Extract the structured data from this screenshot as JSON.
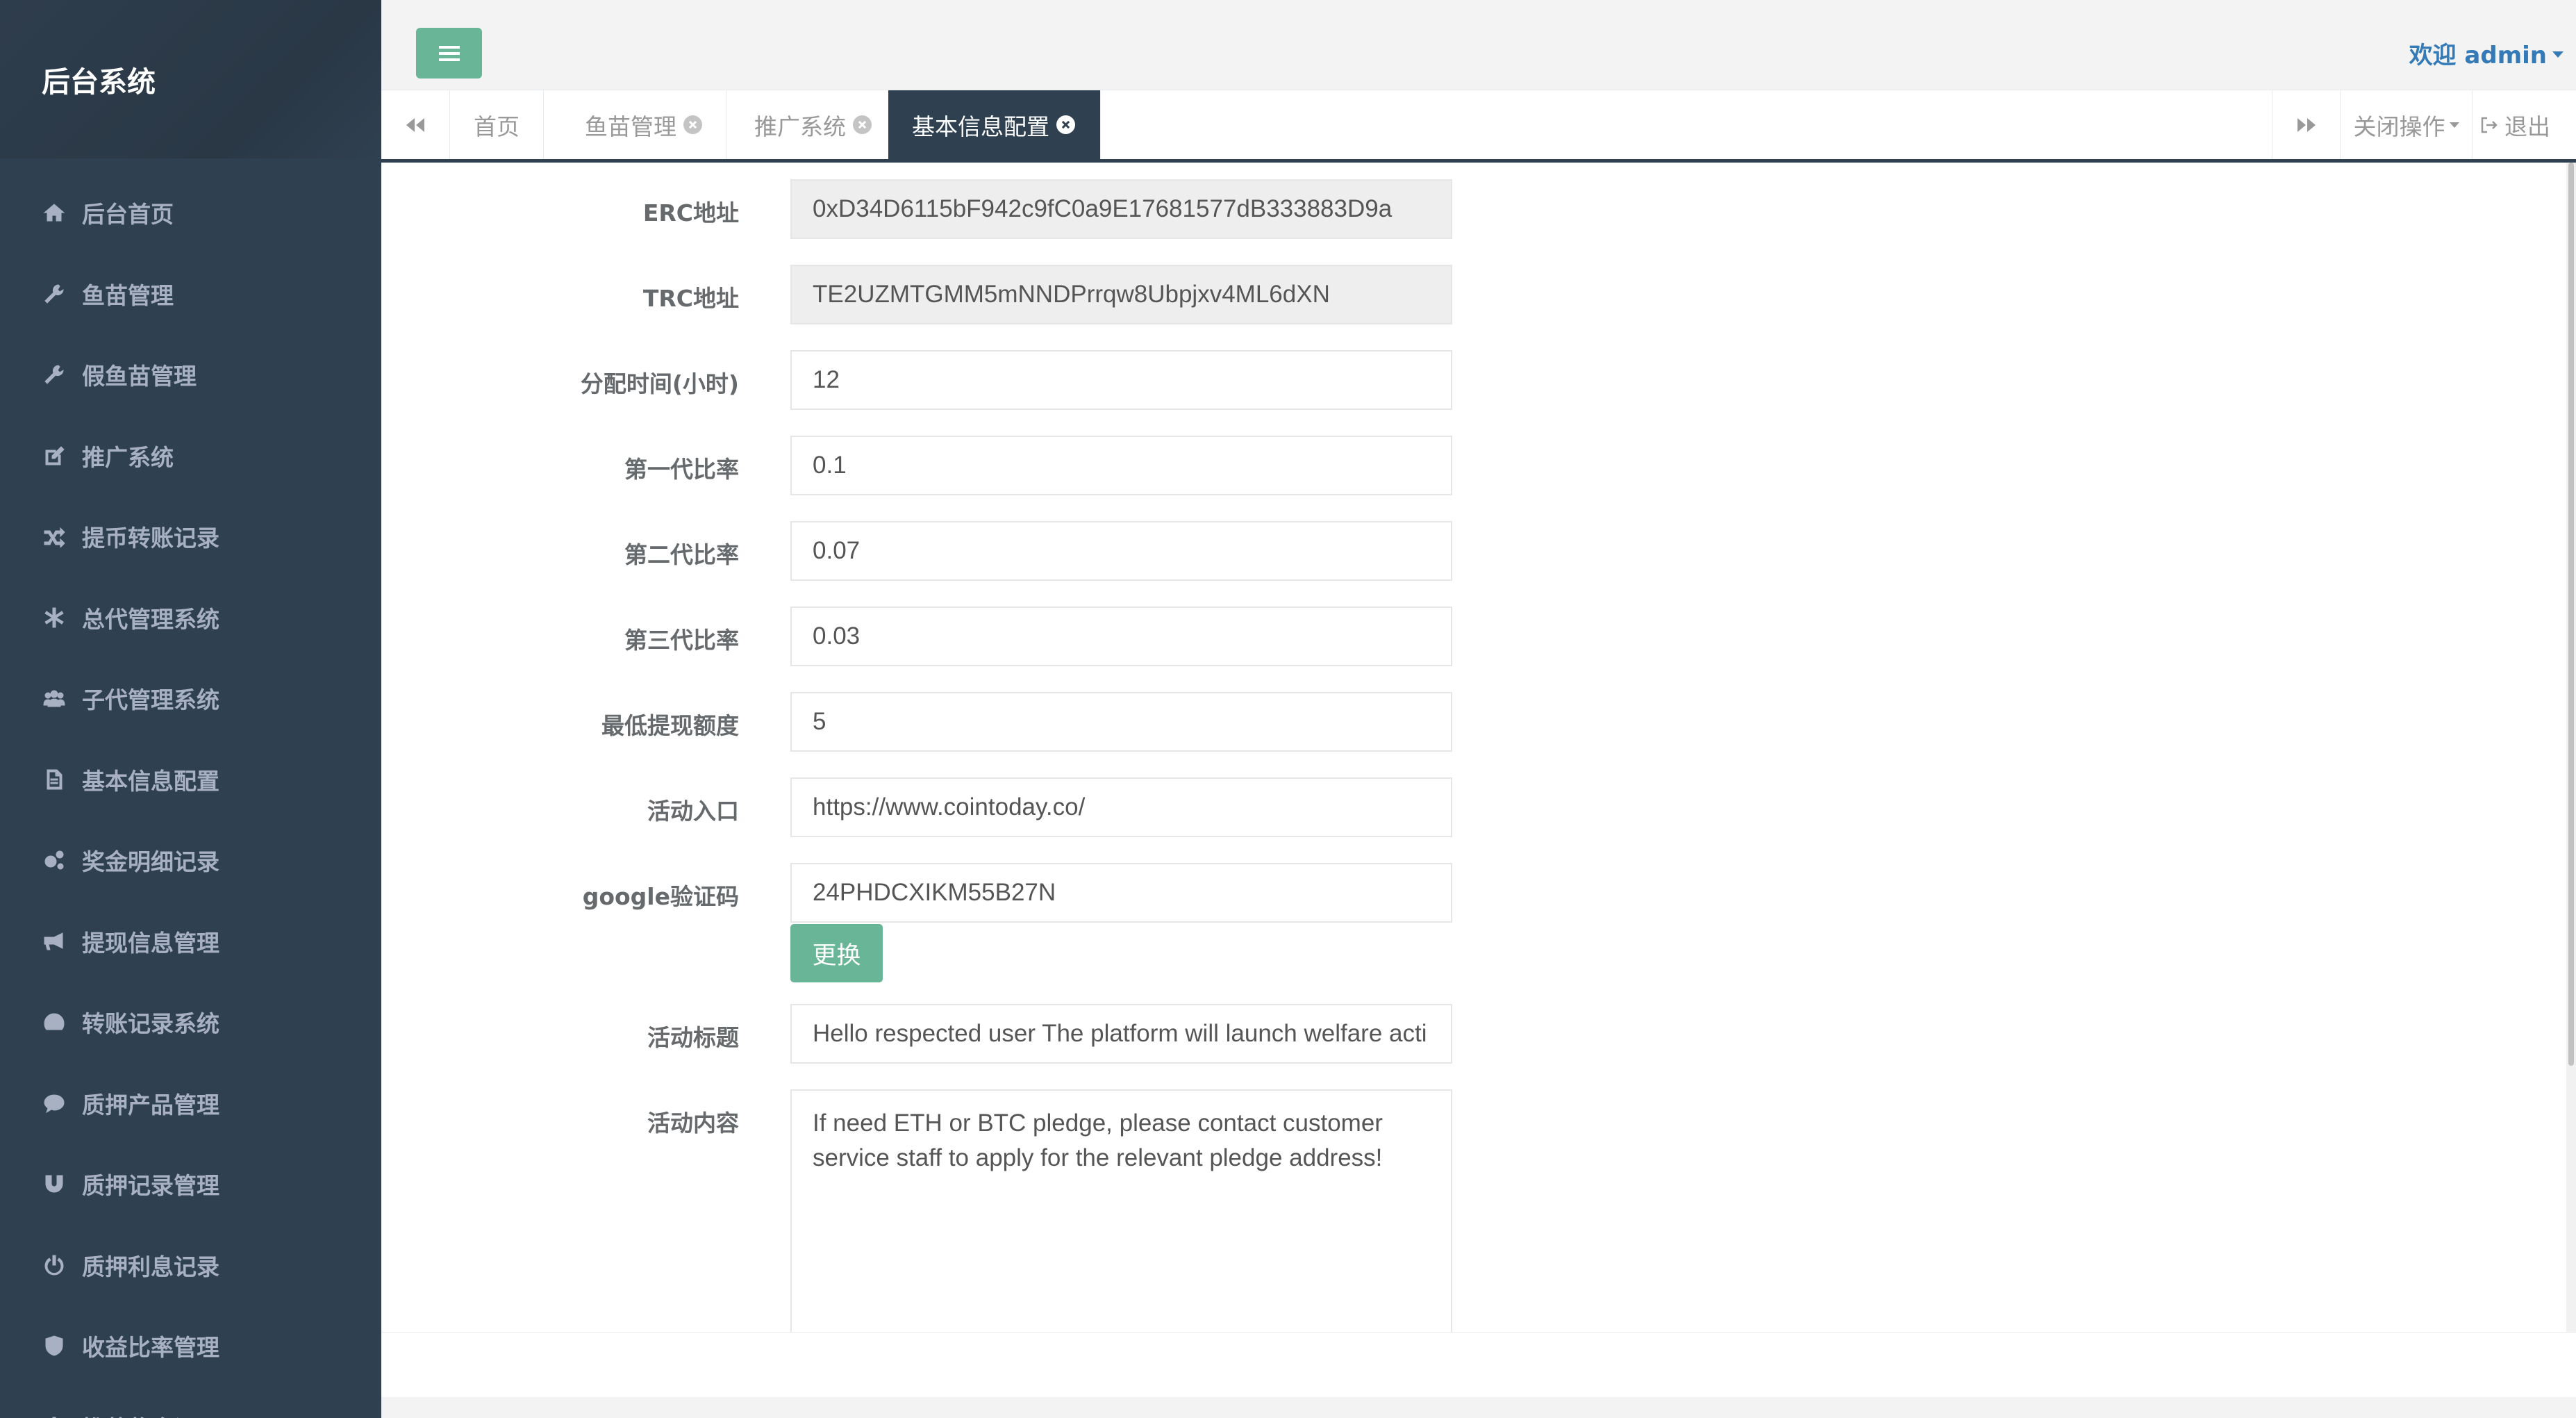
{
  "app": {
    "title": "后台系统"
  },
  "sidebar": {
    "items": [
      {
        "label": "后台首页",
        "icon": "home-icon"
      },
      {
        "label": "鱼苗管理",
        "icon": "wrench-icon"
      },
      {
        "label": "假鱼苗管理",
        "icon": "wrench-icon"
      },
      {
        "label": "推广系统",
        "icon": "edit-icon"
      },
      {
        "label": "提币转账记录",
        "icon": "shuffle-icon"
      },
      {
        "label": "总代管理系统",
        "icon": "asterisk-icon"
      },
      {
        "label": "子代管理系统",
        "icon": "users-icon"
      },
      {
        "label": "基本信息配置",
        "icon": "file-icon"
      },
      {
        "label": "奖金明细记录",
        "icon": "gears-icon"
      },
      {
        "label": "提现信息管理",
        "icon": "bullhorn-icon"
      },
      {
        "label": "转账记录系统",
        "icon": "dashboard-icon"
      },
      {
        "label": "质押产品管理",
        "icon": "comment-icon"
      },
      {
        "label": "质押记录管理",
        "icon": "magnet-icon"
      },
      {
        "label": "质押利息记录",
        "icon": "power-icon"
      },
      {
        "label": "收益比率管理",
        "icon": "shield-icon"
      },
      {
        "label": "推荐奖金记录",
        "icon": "power-icon"
      }
    ]
  },
  "header": {
    "welcome": "欢迎 admin"
  },
  "tabs": {
    "items": [
      {
        "label": "首页"
      },
      {
        "label": "鱼苗管理"
      },
      {
        "label": "推广系统"
      },
      {
        "label": "基本信息配置"
      }
    ],
    "active": "基本信息配置",
    "close_ops": "关闭操作",
    "logout": "退出"
  },
  "form": {
    "erc": {
      "label": "ERC地址",
      "value": "0xD34D6115bF942c9fC0a9E17681577dB333883D9a"
    },
    "trc": {
      "label": "TRC地址",
      "value": "TE2UZMTGMM5mNNDPrrqw8Ubpjxv4ML6dXN"
    },
    "alloc_time": {
      "label": "分配时间(小时)",
      "value": "12"
    },
    "gen1": {
      "label": "第一代比率",
      "value": "0.1"
    },
    "gen2": {
      "label": "第二代比率",
      "value": "0.07"
    },
    "gen3": {
      "label": "第三代比率",
      "value": "0.03"
    },
    "min_withdraw": {
      "label": "最低提现额度",
      "value": "5"
    },
    "activity_entry": {
      "label": "活动入口",
      "value": "https://www.cointoday.co/"
    },
    "google_code": {
      "label": "google验证码",
      "value": "24PHDCXIKM55B27N"
    },
    "change_button": "更换",
    "activity_title": {
      "label": "活动标题",
      "value": "Hello respected user The platform will launch welfare acti"
    },
    "activity_content": {
      "label": "活动内容",
      "value": "If  need ETH or BTC pledge, please contact customer service staff to apply for the relevant pledge address!"
    }
  },
  "colors": {
    "sidebar": "#2f4050",
    "accent": "#69b598",
    "link": "#337ab7"
  }
}
